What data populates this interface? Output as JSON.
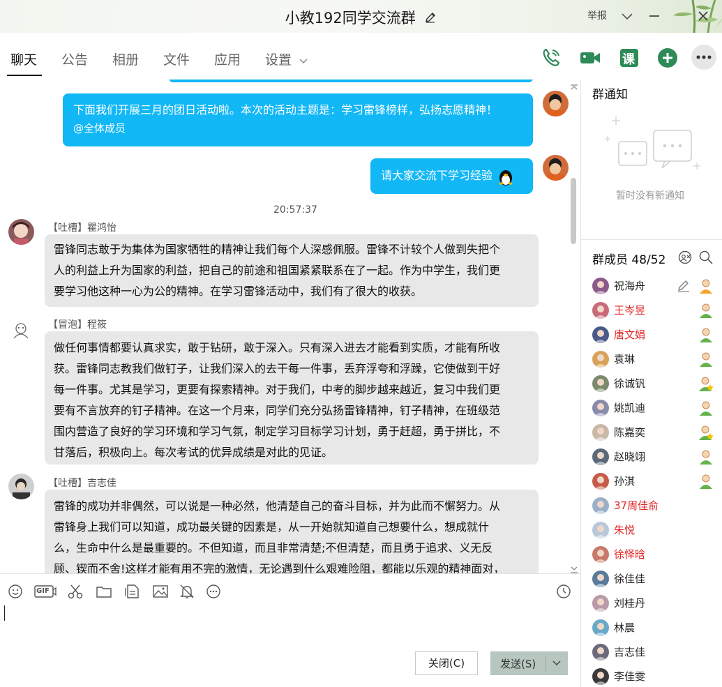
{
  "window": {
    "title": "小教192同学交流群",
    "report_label": "举报"
  },
  "tabs": [
    {
      "label": "聊天",
      "active": true
    },
    {
      "label": "公告"
    },
    {
      "label": "相册"
    },
    {
      "label": "文件"
    },
    {
      "label": "应用"
    },
    {
      "label": "设置"
    }
  ],
  "toolbar_icons": [
    "phone-icon",
    "video-call-icon",
    "class-icon",
    "add-icon",
    "more-icon"
  ],
  "toolbar": {
    "class_label": "课"
  },
  "messages": [
    {
      "type": "me",
      "text": "下面我们开展三月的团日活动啦。本次的活动主题是：学习雷锋榜样，弘扬志愿精神！",
      "mention": "@全体成员"
    },
    {
      "type": "me",
      "text": "请大家交流下学习经验"
    },
    {
      "type": "time",
      "text": "20:57:37"
    },
    {
      "type": "other",
      "sender": "【吐槽】瞿鸿怡",
      "lines": [
        "雷锋同志敢于为集体为国家牺牲的精神让我们每个人深感佩服。雷锋不计较个人做到失把个",
        "人的利益上升为国家的利益，把自己的前途和祖国紧紧联系在了一起。作为中学生，我们更",
        "要学习他这种一心为公的精神。在学习雷锋活动中，我们有了很大的收获。"
      ]
    },
    {
      "type": "other",
      "sender": "【冒泡】程筱",
      "lines": [
        "做任何事情都要认真求实，敢于钻研，敢于深入。只有深入进去才能看到实质，才能有所收",
        "获。雷锋同志教我们做钉子，让我们深入的去干每一件事，丢弃浮夸和浮躁，它使做到干好",
        "每一件事。尤其是学习，更要有探索精神。对于我们，中考的脚步越来越近，复习中我们更",
        "要有不言放弃的钉子精神。在这一个月来，同学们充分弘扬雷锋精神，钉子精神，在班级范",
        "围内营造了良好的学习环境和学习气氛，制定学习目标学习计划，勇于赶超，勇于拼比，不",
        "甘落后，积极向上。每次考试的优异成绩是对此的见证。"
      ]
    },
    {
      "type": "other",
      "sender": "【吐槽】吉志佳",
      "lines": [
        "雷锋的成功并非偶然，可以说是一种必然，他清楚自己的奋斗目标，并为此而不懈努力。从",
        "雷锋身上我们可以知道，成功最关键的因素是，从一开始就知道自己想要什么，想成就什",
        "么，生命中什么是最重要的。不但知道，而且非常清楚;不但清楚，而且勇于追求、义无反",
        "顾、锲而不舍!这样才能有用不完的激情，无论遇到什么艰难险阻，都能以乐观的精神面对，"
      ]
    }
  ],
  "input": {
    "tool_icons": [
      "emoji-icon",
      "gif-icon",
      "scissors-icon",
      "folder-icon",
      "doc-icon",
      "image-icon",
      "bell-icon",
      "more-circle-icon"
    ],
    "gif_label": "GIF",
    "history_icon": "clock-icon",
    "close_label": "关闭(C)",
    "send_label": "发送(S)"
  },
  "notice": {
    "title": "群通知",
    "empty_text": "暂时没有新通知"
  },
  "members": {
    "title": "群成员 48/52",
    "list": [
      {
        "name": "祝海舟",
        "color": "#222222",
        "role": "owner"
      },
      {
        "name": "王岑昱",
        "color": "#e02424",
        "role": "online"
      },
      {
        "name": "唐文娟",
        "color": "#e02424",
        "role": "online"
      },
      {
        "name": "袁琳",
        "color": "#222222",
        "role": "online"
      },
      {
        "name": "徐诚钒",
        "color": "#222222",
        "role": "star"
      },
      {
        "name": "姚凯迪",
        "color": "#222222",
        "role": "online"
      },
      {
        "name": "陈嘉奕",
        "color": "#222222",
        "role": "star"
      },
      {
        "name": "赵晓翊",
        "color": "#222222",
        "role": "online"
      },
      {
        "name": "孙淇",
        "color": "#222222",
        "role": "online"
      },
      {
        "name": "37周佳俞",
        "color": "#e02424",
        "role": ""
      },
      {
        "name": "朱悦",
        "color": "#e02424",
        "role": ""
      },
      {
        "name": "徐怿晗",
        "color": "#e02424",
        "role": ""
      },
      {
        "name": "徐佳佳",
        "color": "#222222",
        "role": ""
      },
      {
        "name": "刘桂丹",
        "color": "#222222",
        "role": ""
      },
      {
        "name": "林晨",
        "color": "#222222",
        "role": ""
      },
      {
        "name": "吉志佳",
        "color": "#222222",
        "role": ""
      },
      {
        "name": "李佳雯",
        "color": "#222222",
        "role": ""
      }
    ]
  },
  "colors": {
    "accent_blue": "#12b7f5",
    "tool_green": "#2e8b57",
    "mention_red": "#e02424"
  }
}
